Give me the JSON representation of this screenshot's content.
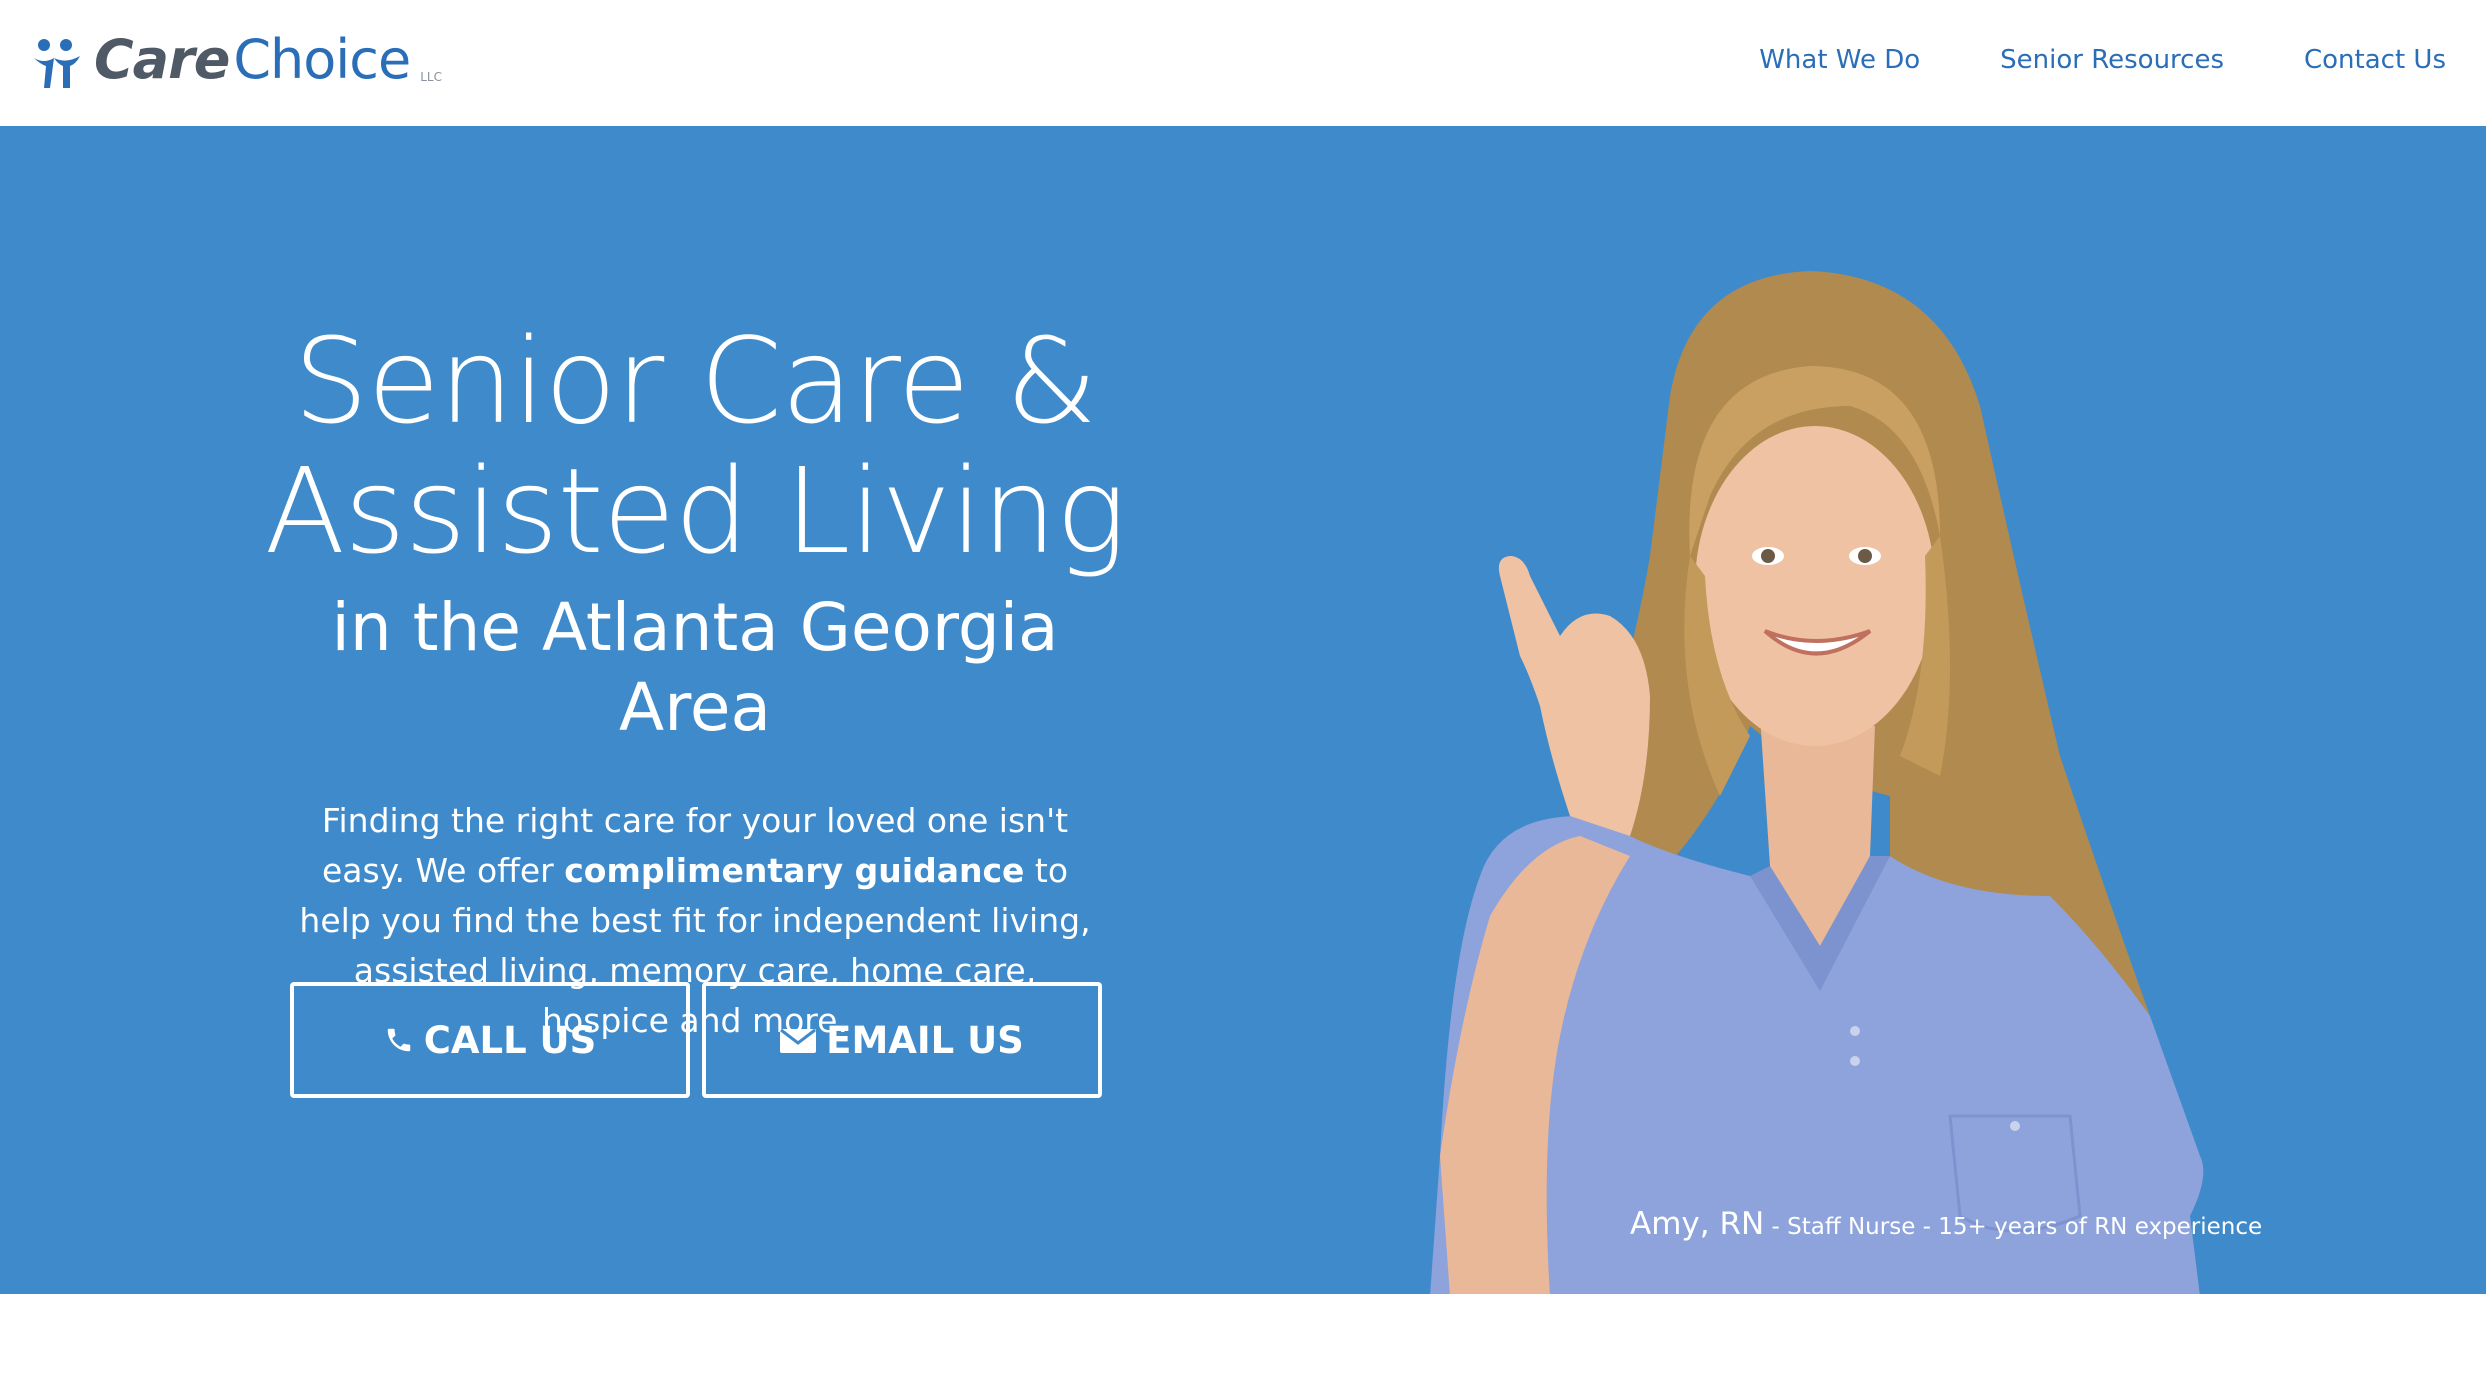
{
  "brand": {
    "care": "Care",
    "choice": "Choice",
    "llc": "LLC",
    "primary_color": "#2a6eb8",
    "hero_color": "#3f8acb",
    "logo_icon": "people-icon"
  },
  "nav": {
    "items": [
      {
        "label": "What We Do"
      },
      {
        "label": "Senior Resources"
      },
      {
        "label": "Contact Us"
      }
    ]
  },
  "hero": {
    "title_line1": "Senior Care &",
    "title_line2": "Assisted Living",
    "subtitle": "in the Atlanta Georgia Area",
    "body_before": "Finding the right care for your loved one isn't easy. We offer ",
    "body_bold": "complimentary guidance",
    "body_after": " to help you find the best fit for independent living, assisted living, memory care, home care, hospice and more.",
    "call_label": "CALL US",
    "call_icon": "phone-icon",
    "email_label": "EMAIL US",
    "email_icon": "envelope-icon"
  },
  "caption": {
    "name": "Amy, RN",
    "role": " - Staff Nurse - 15+ years of RN experience"
  }
}
